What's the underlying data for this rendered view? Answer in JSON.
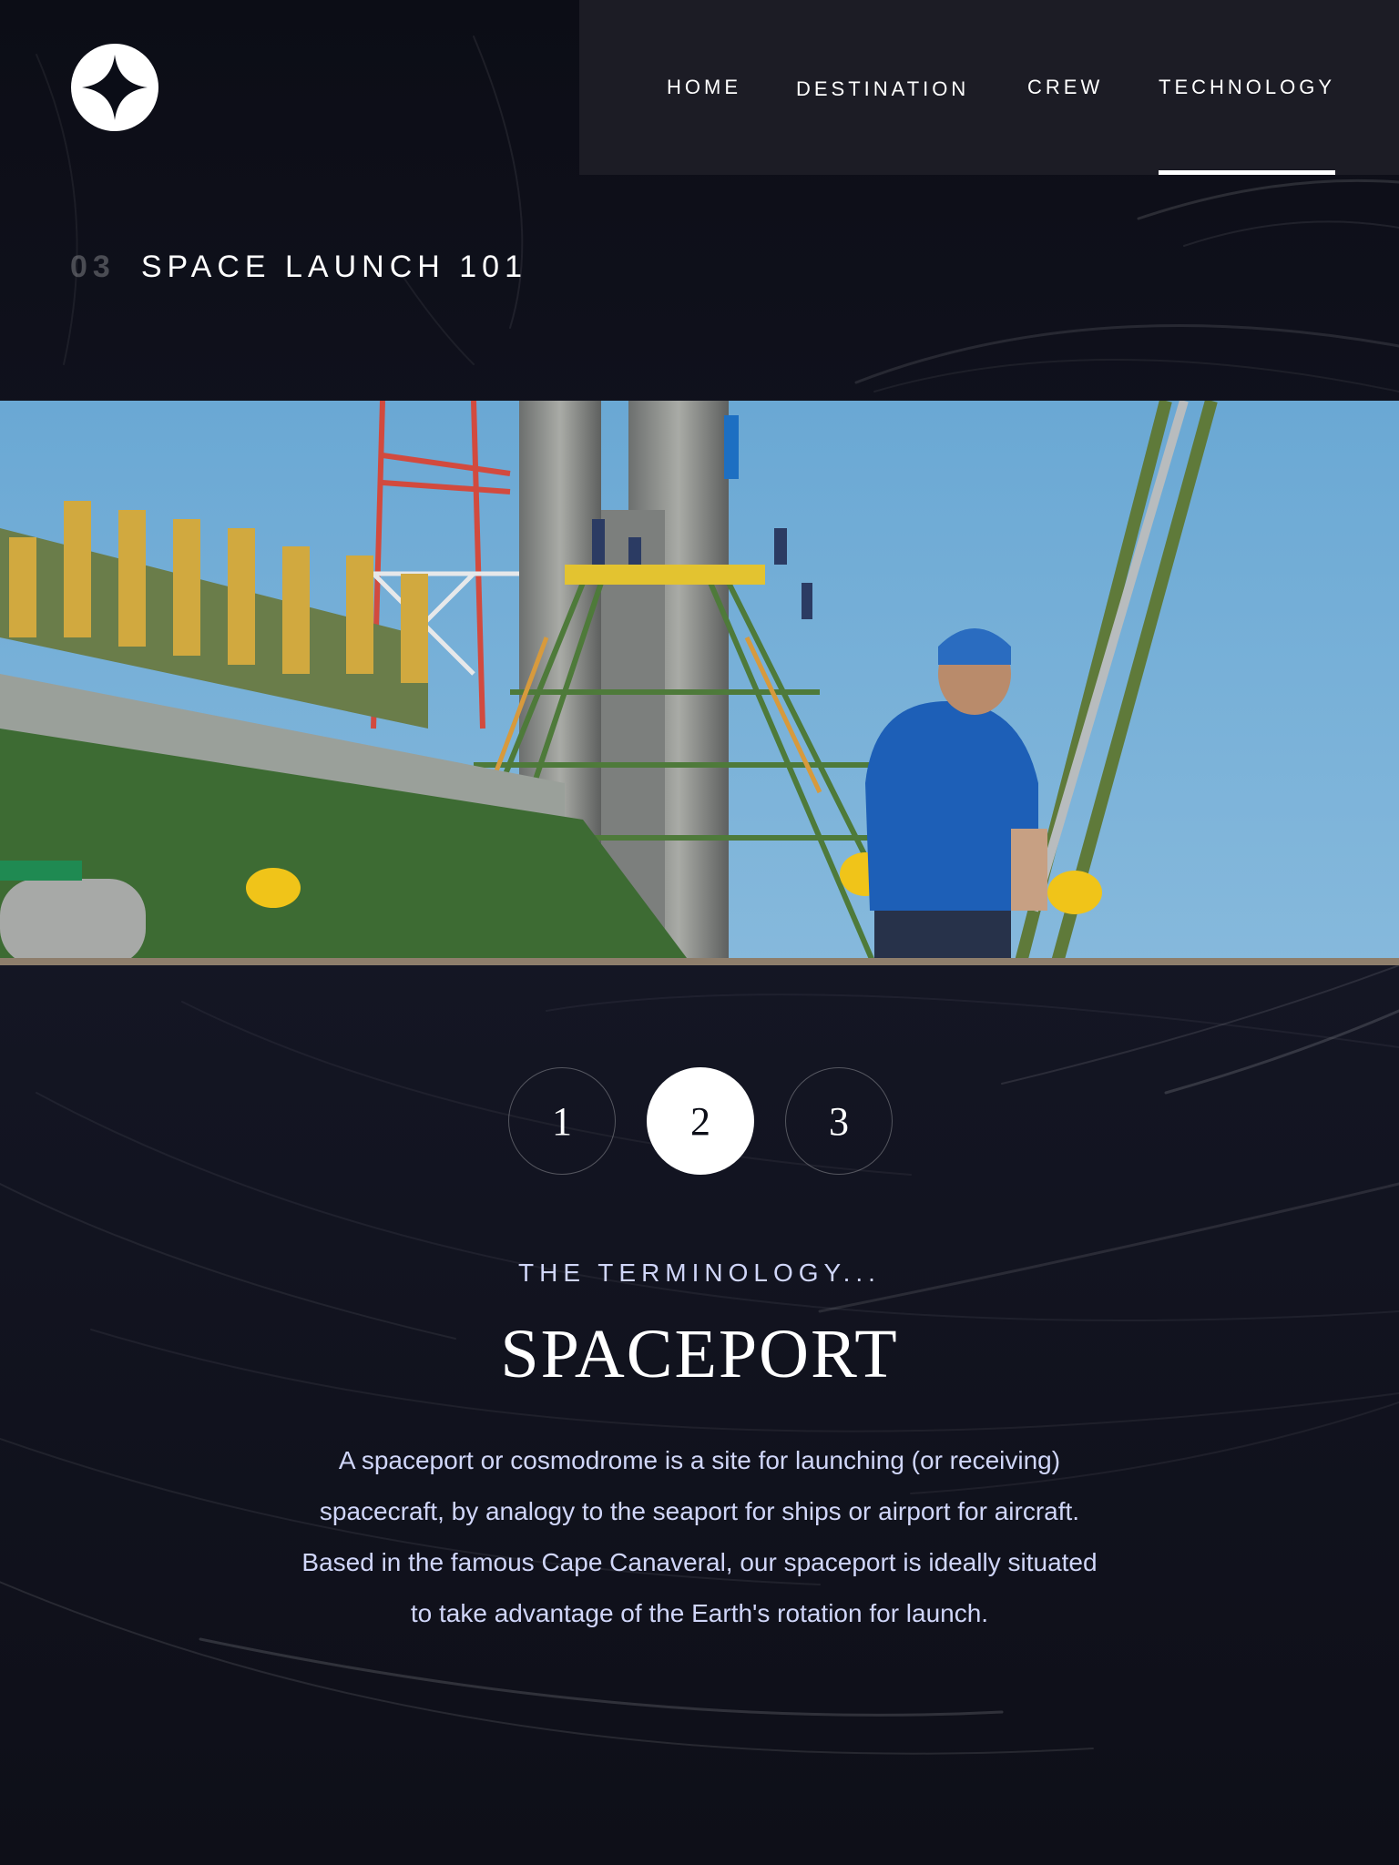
{
  "brand": {
    "logo_icon": "four-point-star-icon"
  },
  "nav": {
    "items": [
      {
        "label": "HOME"
      },
      {
        "label": "DESTINATION"
      },
      {
        "label": "CREW"
      },
      {
        "label": "TECHNOLOGY"
      }
    ],
    "active_index": 3
  },
  "page": {
    "number": "03",
    "title": "SPACE LAUNCH 101"
  },
  "hero": {
    "image_icon": "launch-pad-photo"
  },
  "slides": {
    "buttons": [
      {
        "label": "1"
      },
      {
        "label": "2"
      },
      {
        "label": "3"
      }
    ],
    "active_index": 1
  },
  "technology": {
    "eyebrow": "THE TERMINOLOGY...",
    "name": "SPACEPORT",
    "description": "A spaceport or cosmodrome is a site for launching (or receiving) spacecraft, by analogy to the seaport for ships or airport for aircraft. Based in the famous Cape Canaveral, our spaceport is ideally situated to take advantage of the Earth's rotation for launch."
  },
  "colors": {
    "background": "#0d0e16",
    "nav_background": "#1c1c25",
    "accent_text": "#d0d6f9",
    "white": "#ffffff"
  }
}
